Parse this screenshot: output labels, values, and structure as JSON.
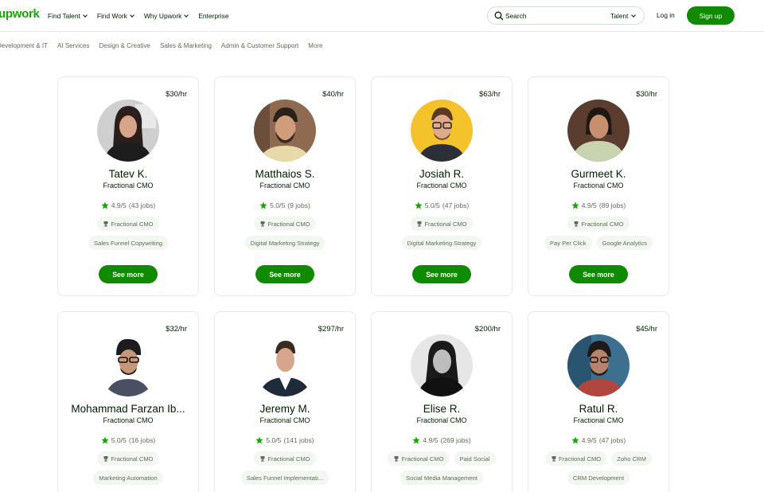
{
  "header": {
    "logo": "upwork",
    "nav": [
      "Find Talent",
      "Find Work",
      "Why Upwork",
      "Enterprise"
    ],
    "search_placeholder": "Search",
    "search_scope": "Talent",
    "login": "Log in",
    "signup": "Sign up"
  },
  "categories": [
    "Development & IT",
    "AI Services",
    "Design & Creative",
    "Sales & Marketing",
    "Admin & Customer Support",
    "More"
  ],
  "cards": [
    {
      "rate": "$30/hr",
      "name": "Tatev K.",
      "title": "Fractional CMO",
      "score": "4.9/5",
      "jobs": "(43 jobs)",
      "badge": "Fractional CMO",
      "skills": [
        "Sales Funnel Copywriting"
      ],
      "button": "See more"
    },
    {
      "rate": "$40/hr",
      "name": "Matthaios S.",
      "title": "Fractional CMO",
      "score": "5.0/5",
      "jobs": "(9 jobs)",
      "badge": "Fractional CMO",
      "skills": [
        "Digital Marketing Strategy"
      ],
      "button": "See more"
    },
    {
      "rate": "$63/hr",
      "name": "Josiah R.",
      "title": "Fractional CMO",
      "score": "5.0/5",
      "jobs": "(47 jobs)",
      "badge": "Fractional CMO",
      "skills": [
        "Digital Marketing Strategy"
      ],
      "button": "See more"
    },
    {
      "rate": "$30/hr",
      "name": "Gurmeet K.",
      "title": "Fractional CMO",
      "score": "4.9/5",
      "jobs": "(89 jobs)",
      "badge": "Fractional CMO",
      "skills": [
        "Pay Per Click",
        "Google Analytics"
      ],
      "button": "See more"
    },
    {
      "rate": "$32/hr",
      "name": "Mohammad Farzan Ib...",
      "title": "Fractional CMO",
      "score": "5.0/5",
      "jobs": "(16 jobs)",
      "badge": "Fractional CMO",
      "skills": [
        "Marketing Automation"
      ]
    },
    {
      "rate": "$297/hr",
      "name": "Jeremy M.",
      "title": "Fractional CMO",
      "score": "5.0/5",
      "jobs": "(141 jobs)",
      "badge": "Fractional CMO",
      "skills": [
        "Sales Funnel Implementati..."
      ]
    },
    {
      "rate": "$200/hr",
      "name": "Elise R.",
      "title": "Fractional CMO",
      "score": "4.9/5",
      "jobs": "(269 jobs)",
      "badge": "Fractional CMO",
      "extra_tag": "Paid Social",
      "skills": [
        "Social Media Management"
      ]
    },
    {
      "rate": "$45/hr",
      "name": "Ratul R.",
      "title": "Fractional CMO",
      "score": "4.9/5",
      "jobs": "(47 jobs)",
      "badge": "Fractional CMO",
      "extra_tag": "Zoho CRM",
      "skills": [
        "CRM Development"
      ]
    }
  ],
  "colors": {
    "brand": "#14a800",
    "button": "#108a00",
    "tag_bg": "#f2f7f2"
  }
}
